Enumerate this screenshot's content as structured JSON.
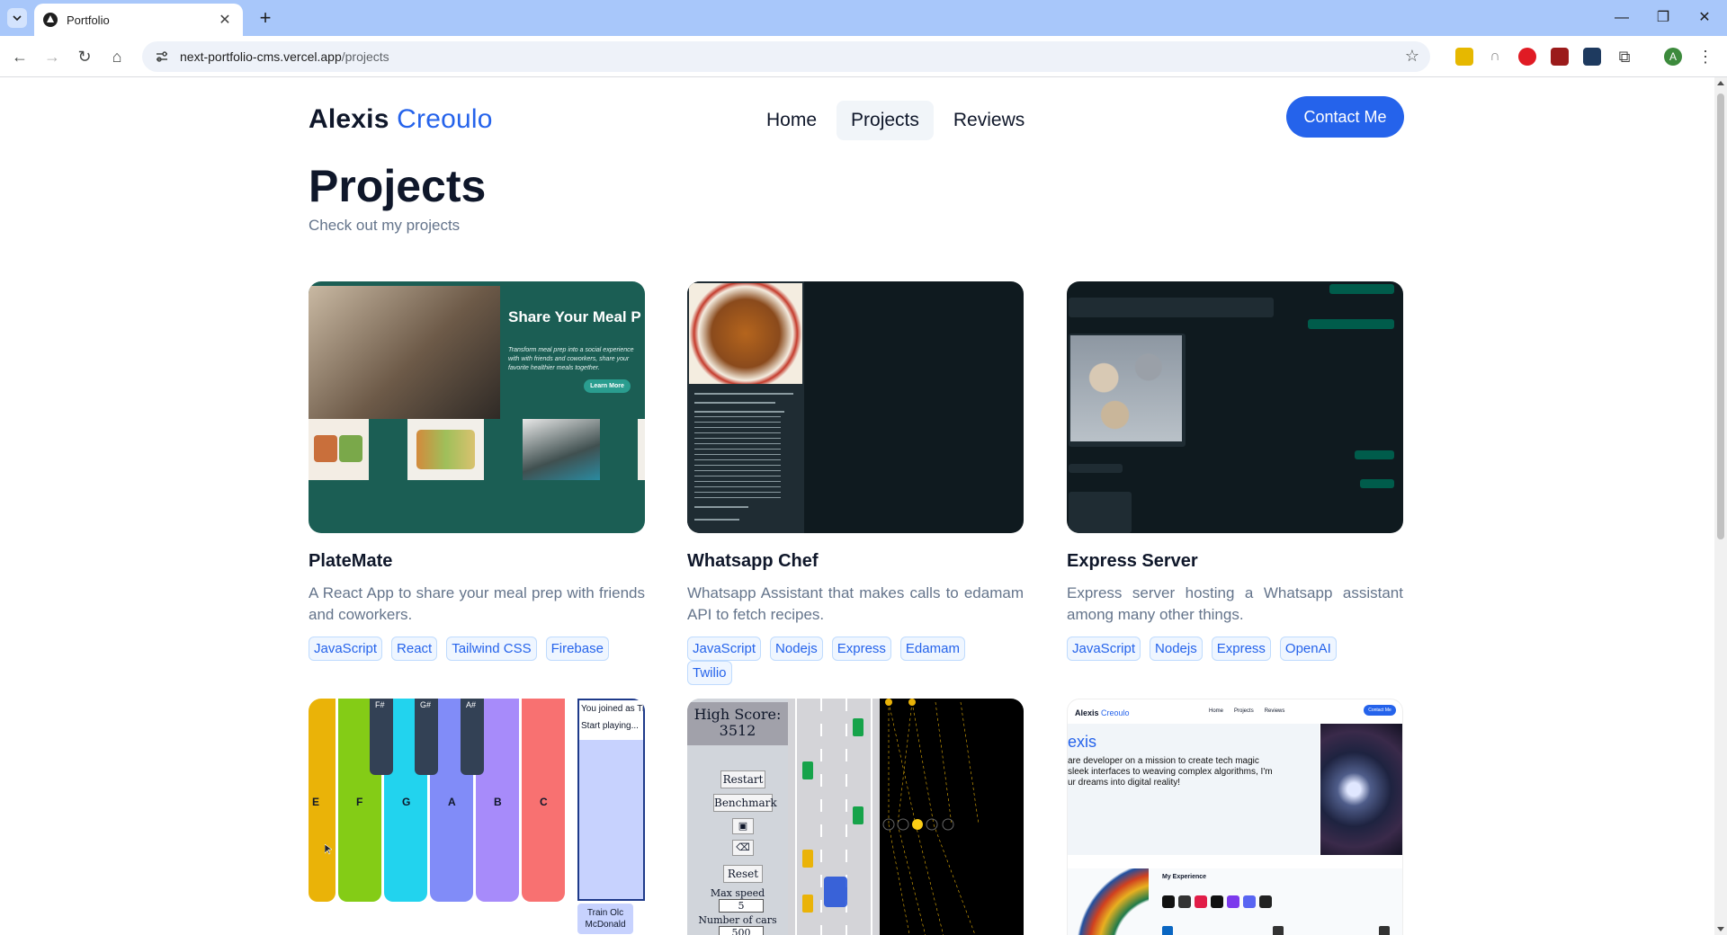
{
  "browser": {
    "tab_title": "Portfolio",
    "url_host": "next-portfolio-cms.vercel.app",
    "url_path": "/projects"
  },
  "header": {
    "logo_first": "Alexis",
    "logo_last": "Creoulo",
    "nav": [
      "Home",
      "Projects",
      "Reviews"
    ],
    "active_nav": "Projects",
    "contact_label": "Contact Me"
  },
  "page": {
    "title": "Projects",
    "subtitle": "Check out my projects"
  },
  "projects": [
    {
      "title": "PlateMate",
      "description": "A React App to share your meal prep with friends and coworkers.",
      "tags": [
        "JavaScript",
        "React",
        "Tailwind CSS",
        "Firebase"
      ],
      "thumb": {
        "heading": "Share Your Meal P Friends and Cow",
        "body": "Transform meal prep into a social experience with with friends and coworkers, share your favorite healthier meals together.",
        "button": "Learn More"
      }
    },
    {
      "title": "Whatsapp Chef",
      "description": "Whatsapp Assistant that makes calls to edamam API to fetch recipes.",
      "tags": [
        "JavaScript",
        "Nodejs",
        "Express",
        "Edamam",
        "Twilio"
      ]
    },
    {
      "title": "Express Server",
      "description": "Express server hosting a Whatsapp assistant among many other things.",
      "tags": [
        "JavaScript",
        "Nodejs",
        "Express",
        "OpenAI"
      ]
    }
  ],
  "piano": {
    "white_keys": [
      "E",
      "F",
      "G",
      "A",
      "B",
      "C"
    ],
    "black_keys": [
      "F#",
      "G#",
      "A#"
    ],
    "joined_text": "You joined as Ti",
    "start_text": "Start playing...",
    "footer_text_1": "Train Olc",
    "footer_text_2": "McDonald"
  },
  "cars": {
    "high_score_label": "High Score:",
    "high_score": "3512",
    "restart": "Restart",
    "benchmark": "Benchmark",
    "reset": "Reset",
    "max_speed_label": "Max speed",
    "max_speed": "5",
    "num_cars_label": "Number of cars",
    "num_cars": "500"
  },
  "portfolio_preview": {
    "logo_first": "Alexis",
    "logo_last": "Creoulo",
    "nav": [
      "Home",
      "Projects",
      "Reviews"
    ],
    "contact": "Contact Me",
    "hero_name": "exis",
    "hero_line1": "are developer on a mission to create tech magic",
    "hero_line2": "sleek interfaces to weaving complex algorithms, I'm",
    "hero_line3": "ur dreams into digital reality!",
    "experience_title": "My Experience"
  },
  "colors": {
    "accent": "#2563eb",
    "platemate_bg": "#1b5e54",
    "dark_chat_bg": "#0f1a1f"
  }
}
